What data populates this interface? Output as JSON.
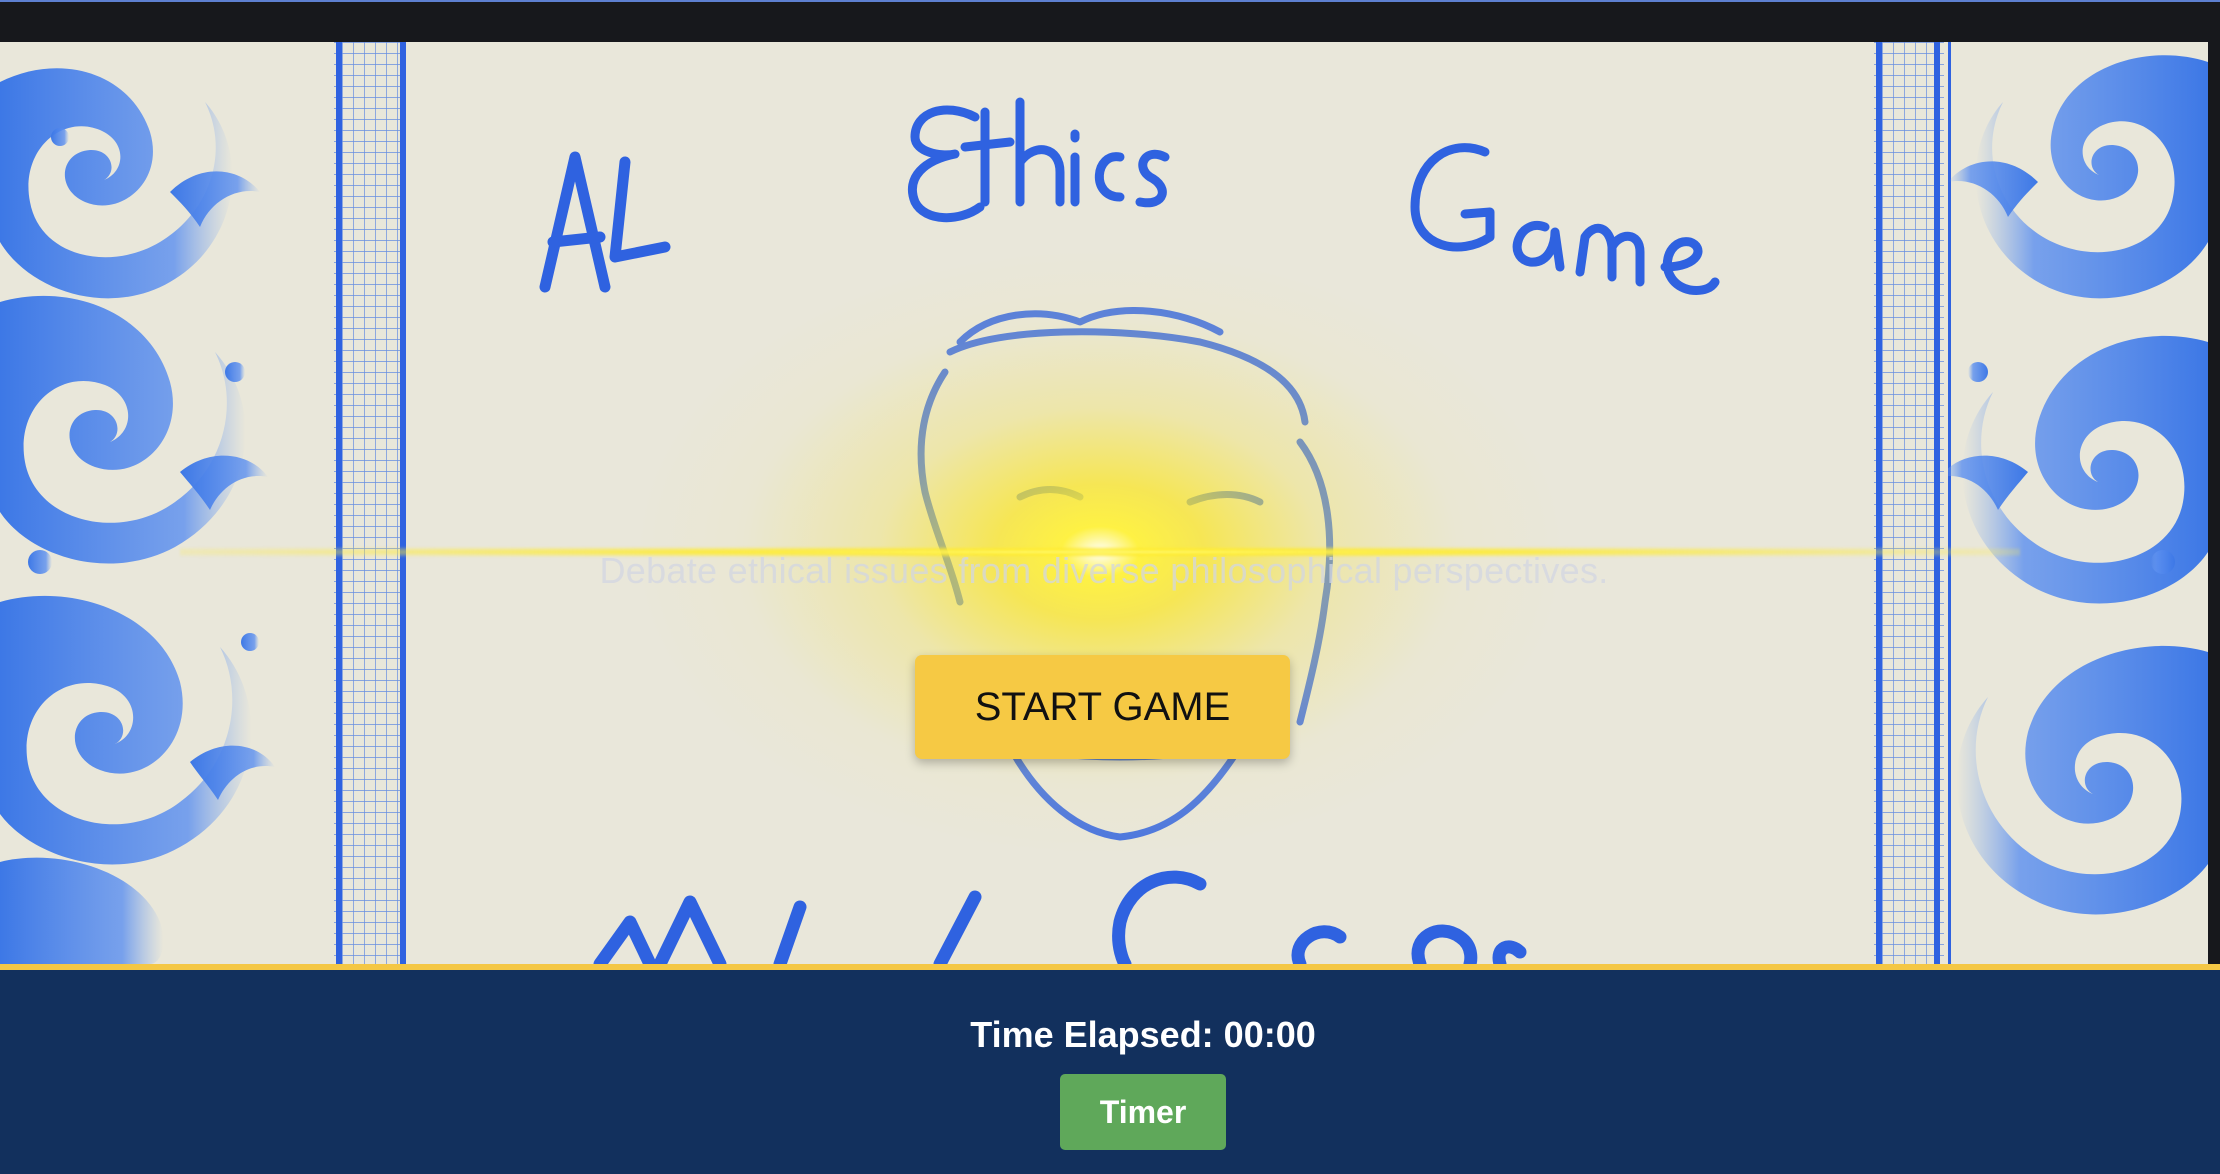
{
  "game": {
    "title_words": [
      "AI",
      "Ethics",
      "Game"
    ],
    "tagline": "Debate ethical issues from diverse philosophical perspectives.",
    "start_button_label": "START GAME",
    "bottom_partial_title": "Mind Game"
  },
  "footer": {
    "timer_text": "Time Elapsed: 00:00",
    "timer_button_label": "Timer"
  },
  "colors": {
    "ink_blue": "#2f62e0",
    "paper": "#e9e7da",
    "start_button": "#f6c944",
    "footer_bg": "#12305d",
    "footer_border": "#f4c745",
    "timer_button": "#5fa85a"
  },
  "icons": [
    "ornament-swirl-left",
    "ornament-swirl-right",
    "face-sketch-icon"
  ]
}
